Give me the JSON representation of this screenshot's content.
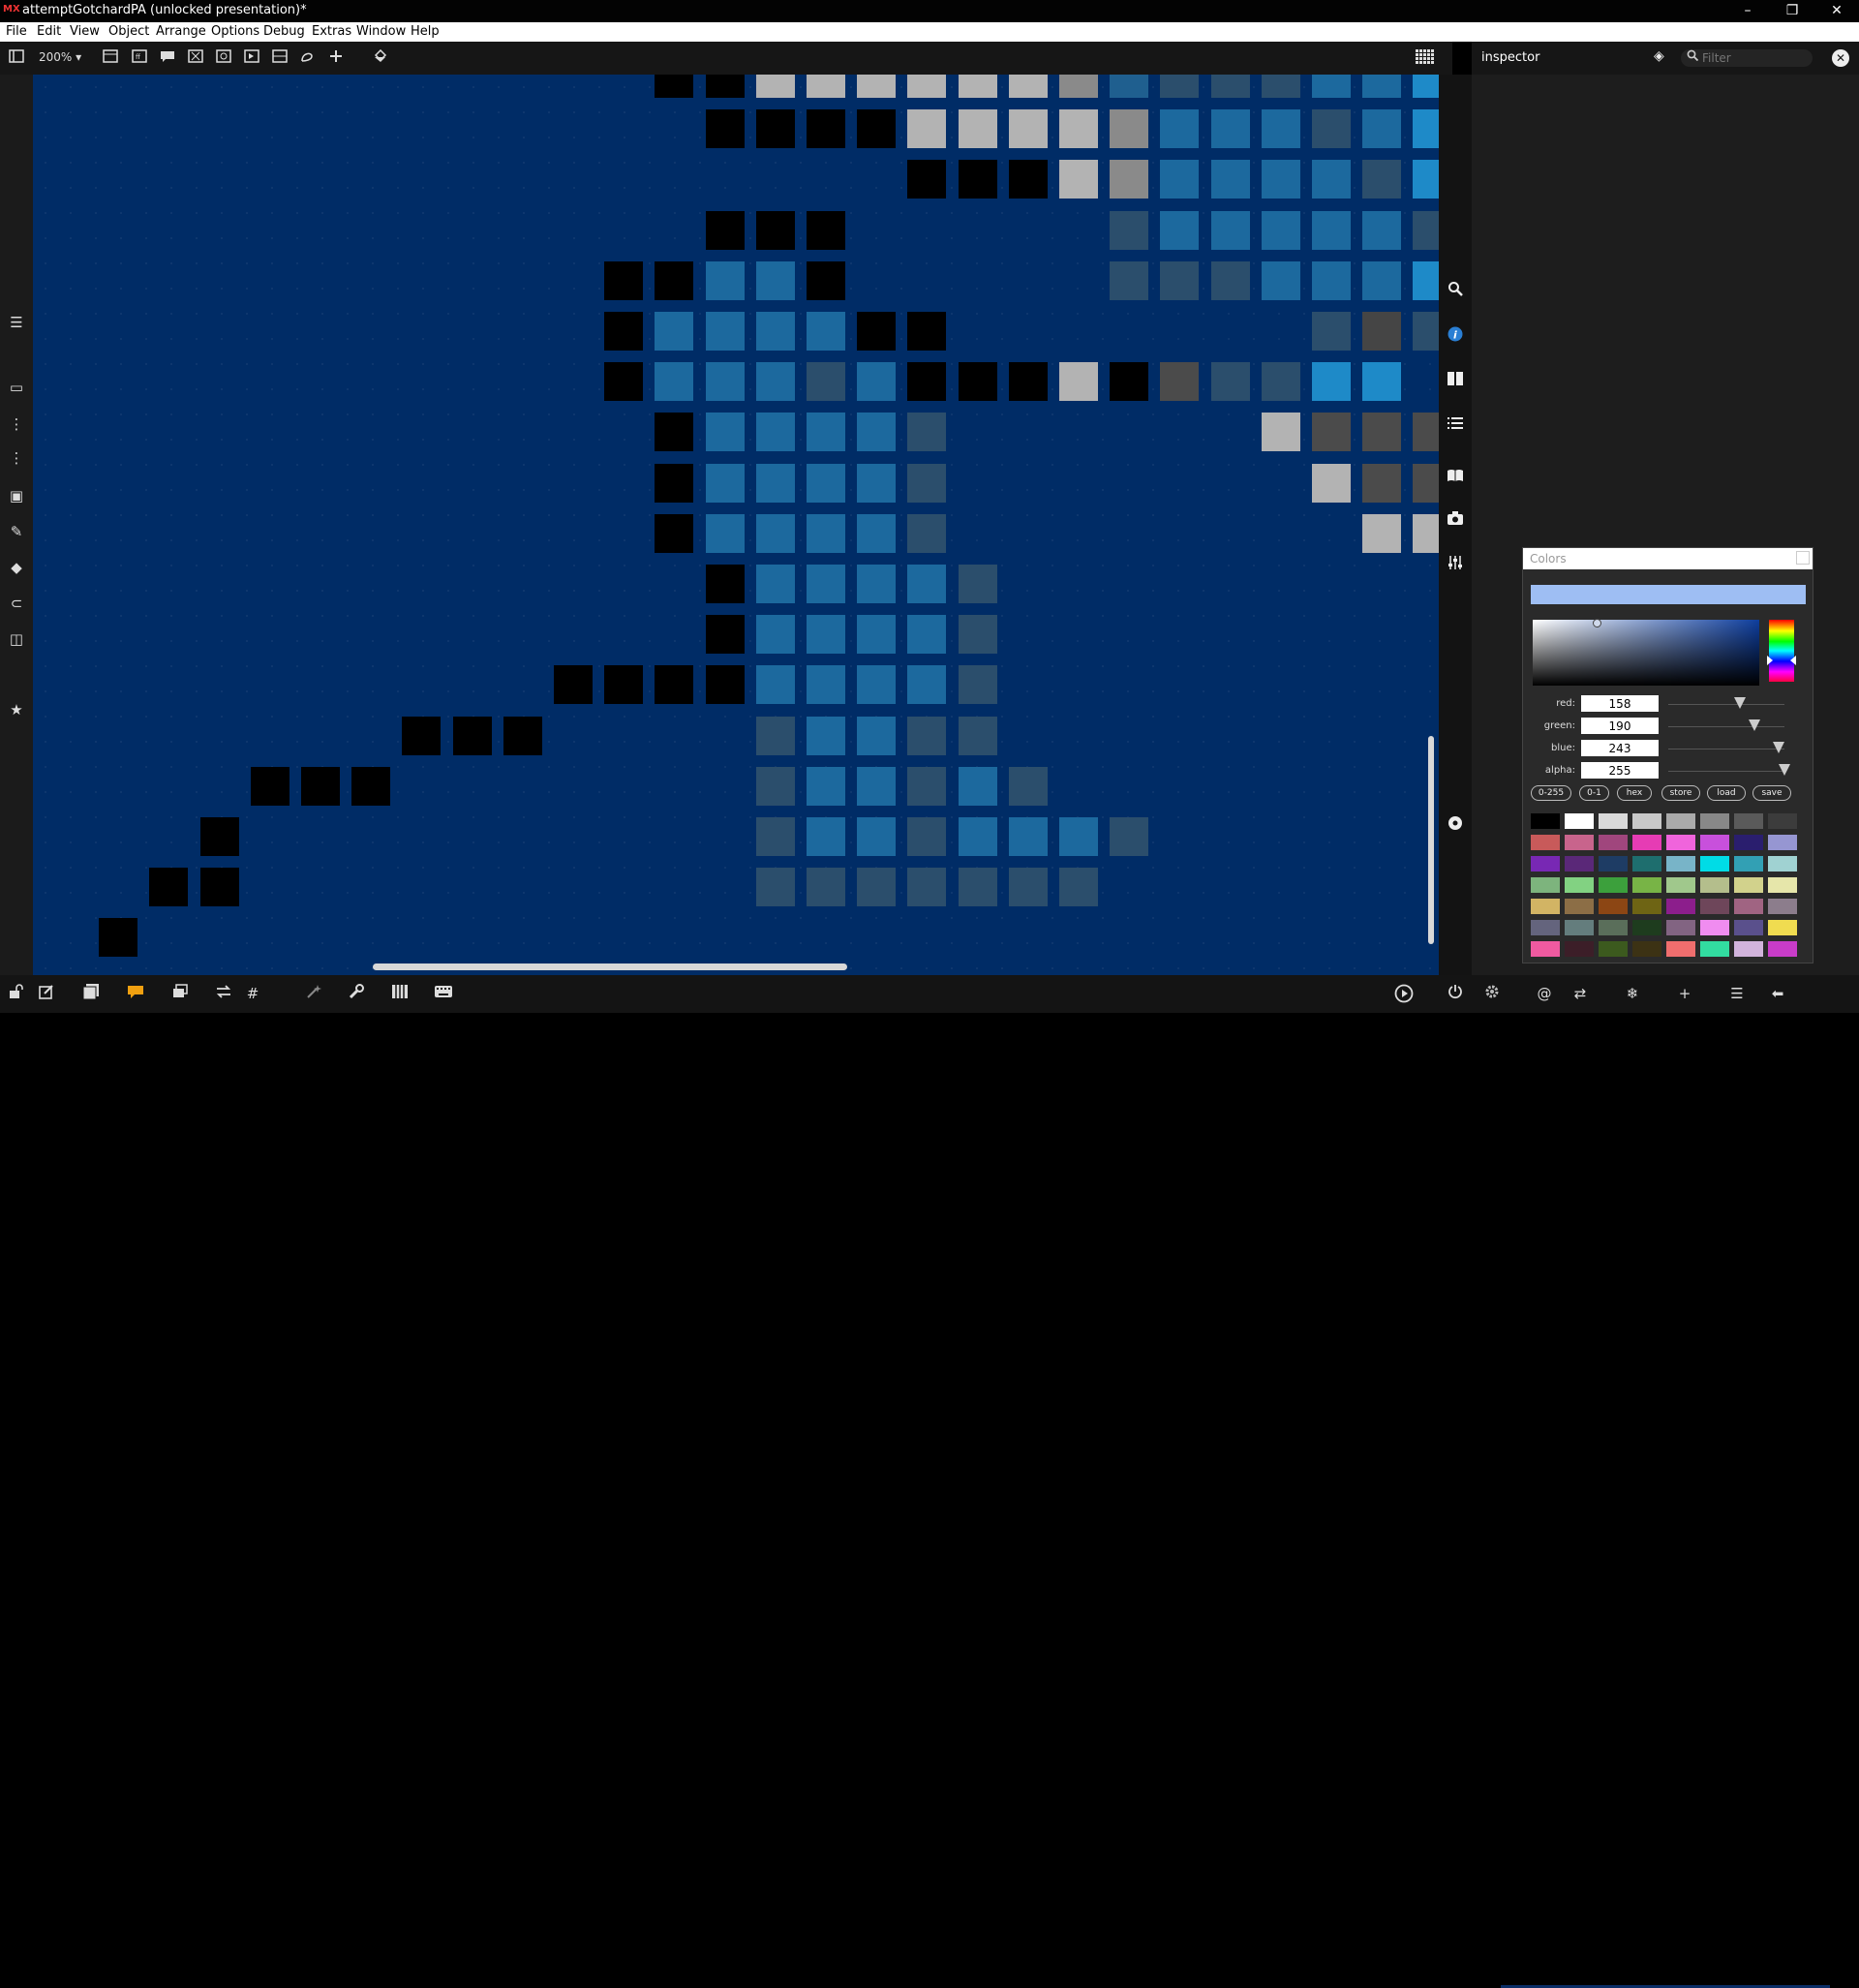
{
  "window": {
    "app_logo": "MX",
    "title": "attemptGotchardPA (unlocked presentation)*",
    "controls": {
      "minimize": "–",
      "restore": "❐",
      "close": "✕"
    }
  },
  "menu": [
    "File",
    "Edit",
    "View",
    "Object",
    "Arrange",
    "Options",
    "Debug",
    "Extras",
    "Window",
    "Help"
  ],
  "toolbar": {
    "zoom": "200%"
  },
  "inspector": {
    "title": "inspector",
    "filter_placeholder": "Filter"
  },
  "colors_panel": {
    "title": "Colors",
    "preview_color": "#9ebef3",
    "channels": [
      {
        "label": "red:",
        "value": "158",
        "fraction": 0.62
      },
      {
        "label": "green:",
        "value": "190",
        "fraction": 0.745
      },
      {
        "label": "blue:",
        "value": "243",
        "fraction": 0.953
      },
      {
        "label": "alpha:",
        "value": "255",
        "fraction": 1.0
      }
    ],
    "buttons": [
      "0-255",
      "0-1",
      "hex",
      "store",
      "load",
      "save"
    ],
    "swatches": [
      "#000000",
      "#ffffff",
      "#d9d9d9",
      "#c8c8c8",
      "#aaaaaa",
      "#888888",
      "#5a5a5a",
      "#3c3c3c",
      "#c85a5a",
      "#c8648c",
      "#a0467d",
      "#e63cb4",
      "#f064dc",
      "#c850dc",
      "#2a1e6e",
      "#9696d2",
      "#7828b4",
      "#5a2878",
      "#1e3c64",
      "#1e6e6e",
      "#78b4c8",
      "#00dce6",
      "#32a0b4",
      "#a0d2d2",
      "#7db47d",
      "#82d282",
      "#3ca03c",
      "#78b446",
      "#a0c88c",
      "#b4be8c",
      "#d2d28c",
      "#e6e6aa",
      "#d2b464",
      "#8c6e46",
      "#8c4614",
      "#6e6414",
      "#8c1e8c",
      "#6e465a",
      "#a06482",
      "#8c7d8c",
      "#64647d",
      "#647d7d",
      "#5a6e5a",
      "#1e3c1e",
      "#826482",
      "#f08cf0",
      "#5a508c",
      "#f0dc50",
      "#f05aa0",
      "#3c1e28",
      "#3c5a1e",
      "#3c3214",
      "#f06e6e",
      "#32dca0",
      "#d2b4dc",
      "#c83cc8"
    ]
  },
  "pixel_art": {
    "colors": {
      "K": "#000000",
      "W": "#b3b3b3",
      "G": "#8a8a8a",
      "B": "#1f5f8f",
      "M": "#1c699e",
      "S": "#2b4e6c",
      "L": "#1e8ac8",
      "D": "#454545",
      "T": "#4b4b4b"
    },
    "rows": [
      {
        "row": 0,
        "cells": "............KKWWWWWWGBSSSMML"
      },
      {
        "row": 1,
        "cells": ".............KKKKWWWWGMMMSML"
      },
      {
        "row": 2,
        "cells": ".................KKKWGMMMMSL"
      },
      {
        "row": 3,
        "cells": ".............KKK.....SMMMMMS"
      },
      {
        "row": 4,
        "cells": "...........KKMMK.....SSSMMML"
      },
      {
        "row": 5,
        "cells": "...........KMMMMKK.......SDSMLL"
      },
      {
        "row": 6,
        "cells": "...........KMMMSMKKKWKTSSLL"
      },
      {
        "row": 7,
        "cells": "............KMMMMS......WTTTSS"
      },
      {
        "row": 8,
        "cells": "............KMMMMS.......WTTTT"
      },
      {
        "row": 9,
        "cells": "............KMMMMS........WWWW"
      },
      {
        "row": 10,
        "cells": ".............KMMMMS"
      },
      {
        "row": 11,
        "cells": ".............KMMMMS"
      },
      {
        "row": 12,
        "cells": "..........KKKKMMMMS"
      },
      {
        "row": 13,
        "cells": ".......KKK....SMMSS"
      },
      {
        "row": 14,
        "cells": "....KKK.......SMMSMS"
      },
      {
        "row": 15,
        "cells": "...K..........SMMSMMMS"
      },
      {
        "row": 16,
        "cells": "..KK..........SSSSSSS"
      },
      {
        "row": 17,
        "cells": ".K"
      }
    ]
  }
}
